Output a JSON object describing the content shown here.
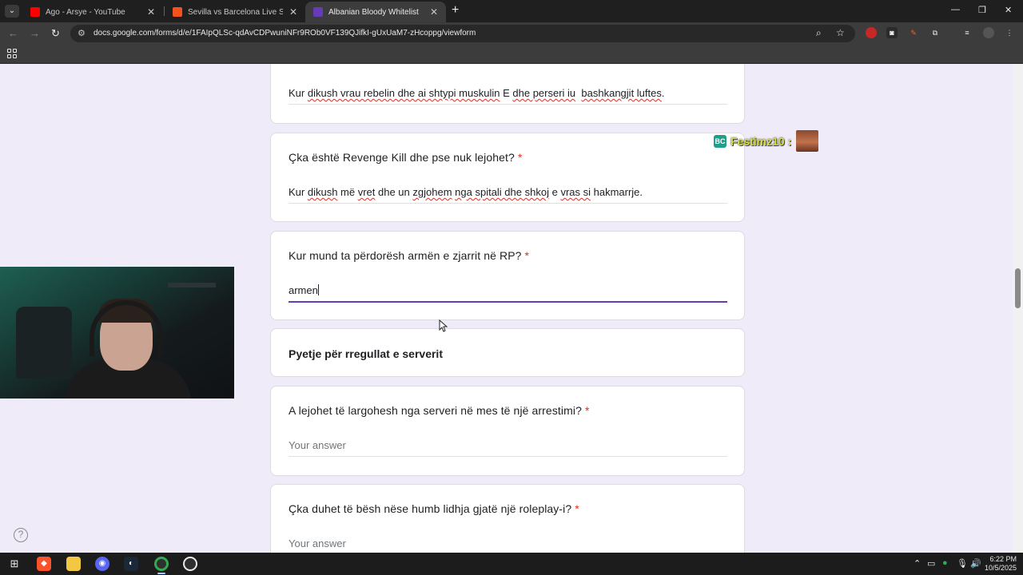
{
  "browser": {
    "tabs": [
      {
        "title": "Ago - Arsye - YouTube",
        "favicon_color": "#ff0000",
        "active": false
      },
      {
        "title": "Sevilla vs Barcelona Live Scores",
        "favicon_color": "#f4511e",
        "active": false
      },
      {
        "title": "Albanian Bloody Whitelist",
        "favicon_color": "#673ab7",
        "active": true
      }
    ],
    "url": "docs.google.com/forms/d/e/1FAIpQLSc-qdAvCDPwuniNFr9ROb0VF139QJifkI-gUxUaM7-zHcoppg/viewform"
  },
  "form": {
    "q_top": {
      "answer_parts": [
        "Kur ",
        "dikush vrau rebelin dhe ai shtypi muskulin",
        " E ",
        "dhe perseri iu",
        "  ",
        "bashkangjit luftes",
        "."
      ]
    },
    "q_revenge": {
      "title": "Çka është Revenge Kill dhe pse nuk lejohet?",
      "required": "*",
      "answer_parts": [
        "Kur ",
        "dikush",
        " më ",
        "vret",
        " dhe un ",
        "zgjohem",
        " ",
        "nga spitali dhe shkoj",
        " e ",
        "vras si",
        " hakmarrje."
      ]
    },
    "q_weapon": {
      "title": "Kur mund ta përdorësh armën e zjarrit në RP?",
      "required": "*",
      "answer": "armen"
    },
    "section": {
      "title": "Pyetje për rregullat e serverit"
    },
    "q_arrest": {
      "title": "A lejohet të largohesh nga serveri në mes të një arrestimi?",
      "required": "*",
      "placeholder": "Your answer"
    },
    "q_disconnect": {
      "title": "Çka duhet të bësh nëse humb lidhja gjatë një roleplay-i?",
      "required": "*",
      "placeholder": "Your answer"
    }
  },
  "overlay": {
    "chat_badge": "BC",
    "chat_user": "Festimz10 :"
  },
  "taskbar": {
    "time": "6:22 PM",
    "date": "10/5/2025"
  },
  "colors": {
    "form_bg": "#f0ebf8",
    "accent": "#673ab7",
    "required": "#d93025"
  }
}
